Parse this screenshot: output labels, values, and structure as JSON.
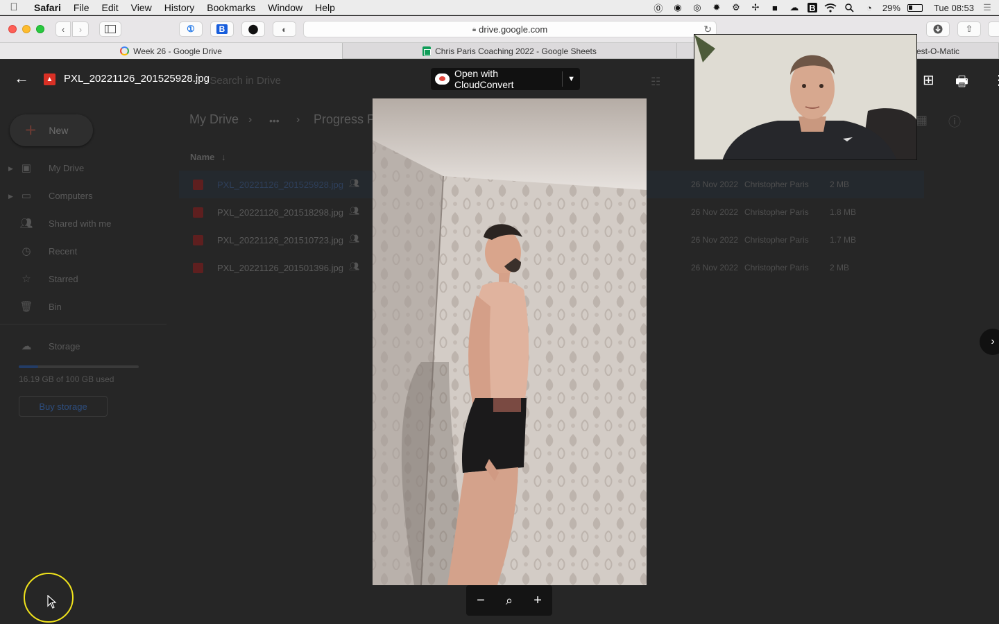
{
  "menubar": {
    "app": "Safari",
    "items": [
      "File",
      "Edit",
      "View",
      "History",
      "Bookmarks",
      "Window",
      "Help"
    ],
    "battery": "29%",
    "clock": "Tue 08:53"
  },
  "browser": {
    "url": "drive.google.com",
    "tabs": [
      {
        "title": "Week 26 - Google Drive"
      },
      {
        "title": "Chris Paris Coaching 2022 - Google Sheets"
      },
      {
        "title": "est-O-Matic"
      }
    ],
    "extensions": [
      "1password-icon",
      "bitwarden-icon",
      "opera-icon",
      "shield-icon"
    ]
  },
  "viewer": {
    "file_title": "PXL_20221126_201525928.jpg",
    "open_with": "Open with CloudConvert",
    "search_placeholder": "Search in Drive"
  },
  "drive": {
    "new_label": "New",
    "nav": [
      {
        "label": "My Drive",
        "icon": "drive-icon"
      },
      {
        "label": "Computers",
        "icon": "computer-icon"
      },
      {
        "label": "Shared with me",
        "icon": "people-icon"
      },
      {
        "label": "Recent",
        "icon": "clock-icon"
      },
      {
        "label": "Starred",
        "icon": "star-icon"
      },
      {
        "label": "Bin",
        "icon": "trash-icon"
      }
    ],
    "storage_label": "Storage",
    "storage_used_text": "16.19 GB of 100 GB used",
    "storage_fraction": 0.16,
    "buy_storage": "Buy storage",
    "breadcrumb": [
      "My Drive",
      "•••",
      "Progress P"
    ],
    "column_name": "Name",
    "files": [
      {
        "name": "PXL_20221126_201525928.jpg",
        "date": "26 Nov 2022",
        "owner": "Christopher Paris",
        "size": "2 MB"
      },
      {
        "name": "PXL_20221126_201518298.jpg",
        "date": "26 Nov 2022",
        "owner": "Christopher Paris",
        "size": "1.8 MB"
      },
      {
        "name": "PXL_20221126_201510723.jpg",
        "date": "26 Nov 2022",
        "owner": "Christopher Paris",
        "size": "1.7 MB"
      },
      {
        "name": "PXL_20221126_201501396.jpg",
        "date": "26 Nov 2022",
        "owner": "Christopher Paris",
        "size": "2 MB"
      }
    ]
  },
  "colors": {
    "accent_blue": "#1a73e8",
    "image_red": "#d93025",
    "cursor_highlight": "#f0e31c"
  }
}
